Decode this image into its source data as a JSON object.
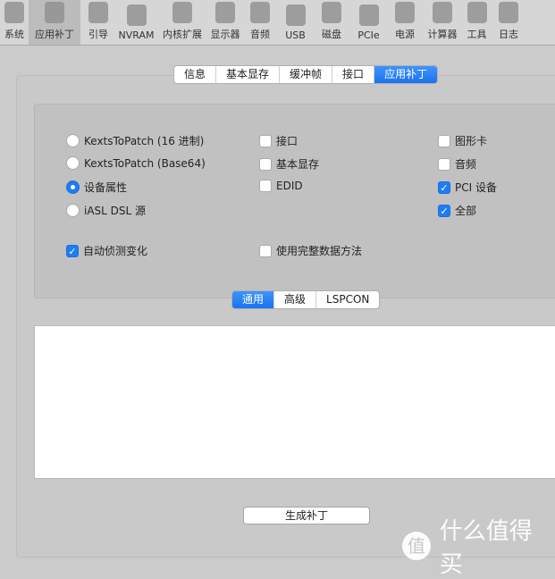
{
  "toolbar": {
    "items": [
      {
        "label": "系统",
        "icon": "computer-icon"
      },
      {
        "label": "应用补丁",
        "icon": "bandage-icon",
        "selected": true
      },
      {
        "label": "引导",
        "icon": "boot-icon"
      },
      {
        "label": "NVRAM",
        "icon": "memory-icon"
      },
      {
        "label": "内核扩展",
        "icon": "lego-brick-icon"
      },
      {
        "label": "显示器",
        "icon": "monitor-icon"
      },
      {
        "label": "音频",
        "icon": "speaker-icon"
      },
      {
        "label": "USB",
        "icon": "usb-icon"
      },
      {
        "label": "磁盘",
        "icon": "disk-icon"
      },
      {
        "label": "PCIe",
        "icon": "pcie-icon"
      },
      {
        "label": "电源",
        "icon": "power-icon"
      },
      {
        "label": "计算器",
        "icon": "calculator-icon"
      },
      {
        "label": "工具",
        "icon": "wrench-icon"
      },
      {
        "label": "日志",
        "icon": "log-icon"
      }
    ]
  },
  "top_tabs": [
    "信息",
    "基本显存",
    "缓冲帧",
    "接口",
    "应用补丁"
  ],
  "top_tabs_selected": "应用补丁",
  "options": {
    "radios": [
      {
        "label": "KextsToPatch (16 进制)",
        "checked": false
      },
      {
        "label": "KextsToPatch (Base64)",
        "checked": false
      },
      {
        "label": "设备属性",
        "checked": true
      },
      {
        "label": "iASL DSL 源",
        "checked": false
      }
    ],
    "col2": [
      {
        "label": "接口",
        "checked": false
      },
      {
        "label": "基本显存",
        "checked": false
      },
      {
        "label": "EDID",
        "checked": false
      }
    ],
    "col3": [
      {
        "label": "图形卡",
        "checked": false
      },
      {
        "label": "音频",
        "checked": false
      },
      {
        "label": "PCI 设备",
        "checked": true
      },
      {
        "label": "全部",
        "checked": true
      }
    ],
    "auto_detect": {
      "label": "自动侦测变化",
      "checked": true
    },
    "full_data": {
      "label": "使用完整数据方法",
      "checked": false
    }
  },
  "sub_tabs": [
    "通用",
    "高级",
    "LSPCON"
  ],
  "sub_tabs_selected": "通用",
  "output_text": "",
  "generate_button": "生成补丁",
  "watermark": {
    "logo": "值",
    "text": "什么值得买"
  },
  "colors": {
    "accent": "#1e7cf4"
  }
}
